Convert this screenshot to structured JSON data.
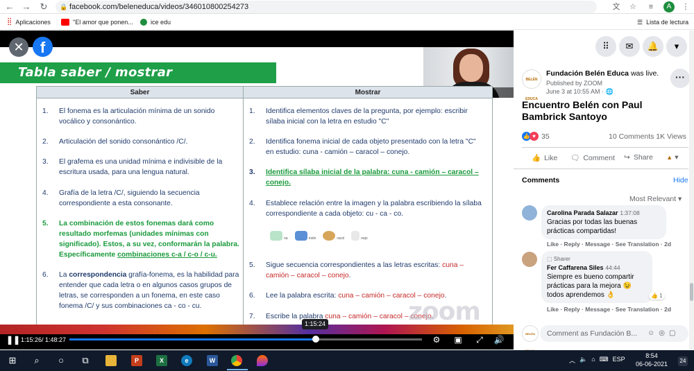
{
  "browser": {
    "url": "facebook.com/beleneduca/videos/346010800254273",
    "avatar_letter": "A"
  },
  "bookmarks": {
    "apps_label": "Aplicaciones",
    "items": [
      "\"El amor que ponen...",
      "ice edu"
    ],
    "reading_list": "Lista de lectura"
  },
  "slide": {
    "title": "Tabla saber / mostrar",
    "col_saber": "Saber",
    "col_mostrar": "Mostrar",
    "saber_items": [
      {
        "num": "1.",
        "text": "El fonema es la articulación mínima de un sonido vocálico y consonántico."
      },
      {
        "num": "2.",
        "text": "Articulación del sonido consonántico /C/."
      },
      {
        "num": "3.",
        "text": "El grafema es  una unidad mínima e indivisible de la escritura usada,  para una lengua natural."
      },
      {
        "num": "4.",
        "text": "Grafía de la letra /C/, siguiendo la secuencia correspondiente a esta consonante."
      },
      {
        "num": "5.",
        "text": "La combinación de estos fonemas dará como resultado morfemas (unidades mínimas con significado). Estos, a su vez, conformarán la palabra. Específicamente ",
        "tail": "combinaciones c-a / c-o / c-u."
      },
      {
        "num": "6.",
        "pre": "La ",
        "bold": "correspondencia",
        "text": " grafía-fonema,  es la habilidad para entender que cada letra o en algunos casos grupos de letras, se corresponden a un fonema, en este caso fonema /C/ y sus combinaciones ca - co - cu."
      }
    ],
    "mostrar_items": [
      {
        "num": "1.",
        "text": "Identifica elementos claves de la pregunta, por ejemplo: escribir sílaba inicial con la letra en estudio \"C\""
      },
      {
        "num": "2.",
        "text": "Identifica fonema inicial de cada objeto presentado con la letra \"C\" en estudio: cuna -  camión – caracol – conejo."
      },
      {
        "num": "3.",
        "text": "Identifica sílaba inicial de la palabra: cuna -  camión – caracol – conejo."
      },
      {
        "num": "4.",
        "text": "Establece relación entre la imagen y la palabra escribiendo la sílaba correspondiente a cada objeto: cu - ca - co."
      },
      {
        "num": "5.",
        "text": "Sigue secuencia correspondientes a las letras escritas: ",
        "red": "cuna – camión – caracol – conejo",
        "end": "."
      },
      {
        "num": "6.",
        "text": "Lee la palabra escrita: ",
        "red": "cuna – camión – caracol – conejo",
        "end": "."
      },
      {
        "num": "7.",
        "text": "Escribe la palabra ",
        "red": "cuna – camión – caracol – conejo",
        "end": "."
      }
    ],
    "pic_labels": [
      "na",
      "mión",
      "racol",
      "nejo"
    ],
    "watermark": "zoom"
  },
  "camera": {
    "name": "Alejandra Dan..."
  },
  "player": {
    "time": "1:15:26/ 1:48:27",
    "tooltip": "1:15:24",
    "progress": 0.698
  },
  "post": {
    "page_name": "Fundación Belén Educa",
    "status": " was live.",
    "published_by": "Published by ZOOM",
    "time": "June 3 at 10:55 AM · ",
    "logo_text": "BELÉN EDUCA",
    "title": "Encuentro Belén con Paul Bambrick Santoyo",
    "reaction_count": "35",
    "counts": "10 Comments  1K Views",
    "like": "Like",
    "comment": "Comment",
    "share": "Share"
  },
  "comments": {
    "header": "Comments",
    "hide": "Hide",
    "sort": "Most Relevant",
    "items": [
      {
        "name": "Carolina Parada Salazar",
        "time": "1:37:08",
        "text": "Gracias por todas las buenas prácticas compartidas!",
        "meta": "Like · Reply · Message · See Translation · 2d"
      },
      {
        "badge": "Sharer",
        "name": "Fer Caffarena Siles",
        "time": "44:44",
        "text": "Siempre es bueno compartir prácticas para la mejora 😉 todos aprendemos 👌",
        "likes": "1",
        "meta": "Like · Reply · Message · See Translation · 2d"
      }
    ],
    "input_placeholder": "Comment as Fundación B..."
  },
  "taskbar": {
    "lang": "ESP",
    "time": "8:54",
    "date": "06-06-2021",
    "notif": "24"
  },
  "colors": {
    "fb_blue": "#1877f2",
    "slide_green": "#1e9f48",
    "taskbar": "#101a2b"
  }
}
